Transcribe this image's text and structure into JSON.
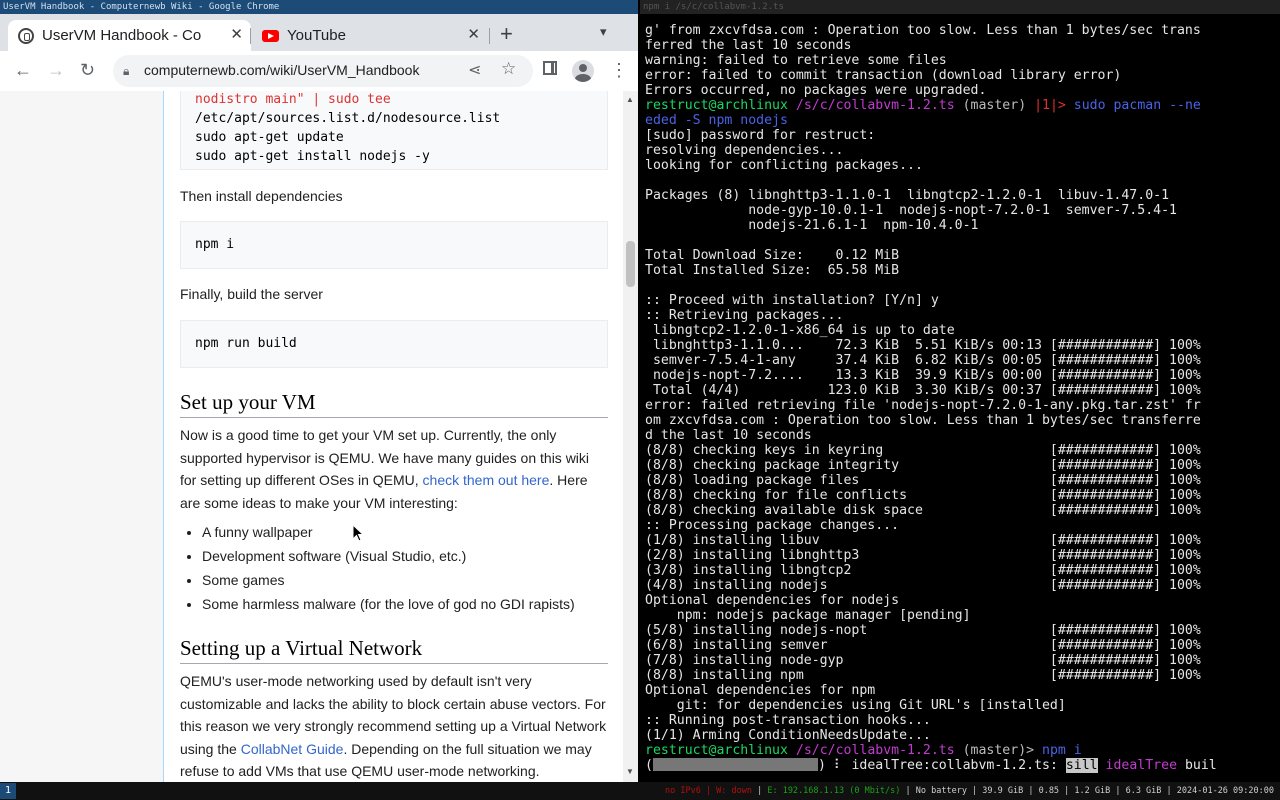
{
  "browser": {
    "wm_title": "UserVM Handbook - Computernewb Wiki - Google Chrome",
    "tabs": [
      {
        "label": "UserVM Handbook - Com",
        "icon": "wiki-favicon",
        "active": true
      },
      {
        "label": "YouTube",
        "icon": "youtube-favicon",
        "active": false
      }
    ],
    "url": "computernewb.com/wiki/UserVM_Handbook",
    "code1": [
      "nodistro main\" | sudo tee",
      "/etc/apt/sources.list.d/nodesource.list",
      "sudo apt-get update",
      "sudo apt-get install nodejs -y"
    ],
    "text_deps": "Then install dependencies",
    "code2": "npm i",
    "text_build": "Finally, build the server",
    "code3": "npm run build",
    "h_setup": "Set up your VM",
    "para_setup_1": "Now is a good time to get your VM set up. Currently, the only supported hypervisor is QEMU. We have many guides on this wiki for setting up different OSes in QEMU,",
    "para_setup_link": "check them out here",
    "para_setup_2": ". Here are some ideas to make your VM interesting:",
    "bullets": [
      "A funny wallpaper",
      "Development software (Visual Studio, etc.)",
      "Some games",
      "Some harmless malware (for the love of god no GDI rapists)"
    ],
    "h_network": "Setting up a Virtual Network",
    "para_net_1": "QEMU's user-mode networking used by default isn't very customizable and lacks the ability to block certain abuse vectors. For this reason we very strongly recommend setting up a Virtual Network using the",
    "para_net_link": "CollabNet Guide",
    "para_net_2": ". Depending on the full situation we may refuse to add VMs that use QEMU user-mode networking."
  },
  "terminal": {
    "wm_title": "npm i /s/c/collabvm-1.2.ts",
    "lines": [
      "g' from zxcvfdsa.com : Operation too slow. Less than 1 bytes/sec trans",
      "ferred the last 10 seconds",
      "warning: failed to retrieve some files",
      "error: failed to commit transaction (download library error)",
      "Errors occurred, no packages were upgraded.",
      "__PROMPT1__",
      "__PROMPT1B__",
      "[sudo] password for restruct:",
      "resolving dependencies...",
      "looking for conflicting packages...",
      "",
      "Packages (8) libnghttp3-1.1.0-1  libngtcp2-1.2.0-1  libuv-1.47.0-1",
      "             node-gyp-10.0.1-1  nodejs-nopt-7.2.0-1  semver-7.5.4-1",
      "             nodejs-21.6.1-1  npm-10.4.0-1",
      "",
      "Total Download Size:    0.12 MiB",
      "Total Installed Size:  65.58 MiB",
      "",
      ":: Proceed with installation? [Y/n] y",
      ":: Retrieving packages...",
      " libngtcp2-1.2.0-1-x86_64 is up to date",
      " libnghttp3-1.1.0...    72.3 KiB  5.51 KiB/s 00:13 [############] 100%",
      " semver-7.5.4-1-any     37.4 KiB  6.82 KiB/s 00:05 [############] 100%",
      " nodejs-nopt-7.2....    13.3 KiB  39.9 KiB/s 00:00 [############] 100%",
      " Total (4/4)           123.0 KiB  3.30 KiB/s 00:37 [############] 100%",
      "error: failed retrieving file 'nodejs-nopt-7.2.0-1-any.pkg.tar.zst' fr",
      "om zxcvfdsa.com : Operation too slow. Less than 1 bytes/sec transferre",
      "d the last 10 seconds",
      "(8/8) checking keys in keyring                     [############] 100%",
      "(8/8) checking package integrity                   [############] 100%",
      "(8/8) loading package files                        [############] 100%",
      "(8/8) checking for file conflicts                  [############] 100%",
      "(8/8) checking available disk space                [############] 100%",
      ":: Processing package changes...",
      "(1/8) installing libuv                             [############] 100%",
      "(2/8) installing libnghttp3                        [############] 100%",
      "(3/8) installing libngtcp2                         [############] 100%",
      "(4/8) installing nodejs                            [############] 100%",
      "Optional dependencies for nodejs",
      "    npm: nodejs package manager [pending]",
      "(5/8) installing nodejs-nopt                       [############] 100%",
      "(6/8) installing semver                            [############] 100%",
      "(7/8) installing node-gyp                          [############] 100%",
      "(8/8) installing npm                               [############] 100%",
      "Optional dependencies for npm",
      "    git: for dependencies using Git URL's [installed]",
      ":: Running post-transaction hooks...",
      "(1/1) Arming ConditionNeedsUpdate...",
      "__PROMPT2__",
      "__PROGRESS__"
    ],
    "prompt1": {
      "user": "restruct@archlinux",
      "path": "/s/c/collabvm-1.2.ts",
      "branch": "(master)",
      "status": "|1|>",
      "cmd": "sudo pacman --ne",
      "cmd_cont": "eded -S npm nodejs"
    },
    "prompt2": {
      "user": "restruct@archlinux",
      "path": "/s/c/collabvm-1.2.ts",
      "branch": "(master)>",
      "cmd": "npm i"
    },
    "progress": {
      "bar_open": "(",
      "bar_close": ")",
      "spinner": "⠇",
      "text": "idealTree:collabvm-1.2.ts:",
      "badge": "sill",
      "tail_colored": "idealTree",
      "tail": "buil"
    }
  },
  "statusbar": {
    "workspace": "1",
    "items_red": "no IPv6 | W: down",
    "item_green": "E: 192.168.1.13 (0 Mbit/s)",
    "items_rest": "No battery | 39.9 GiB | 0.85 | 1.2 GiB | 6.3 GiB | 2024-01-26 09:20:00"
  }
}
